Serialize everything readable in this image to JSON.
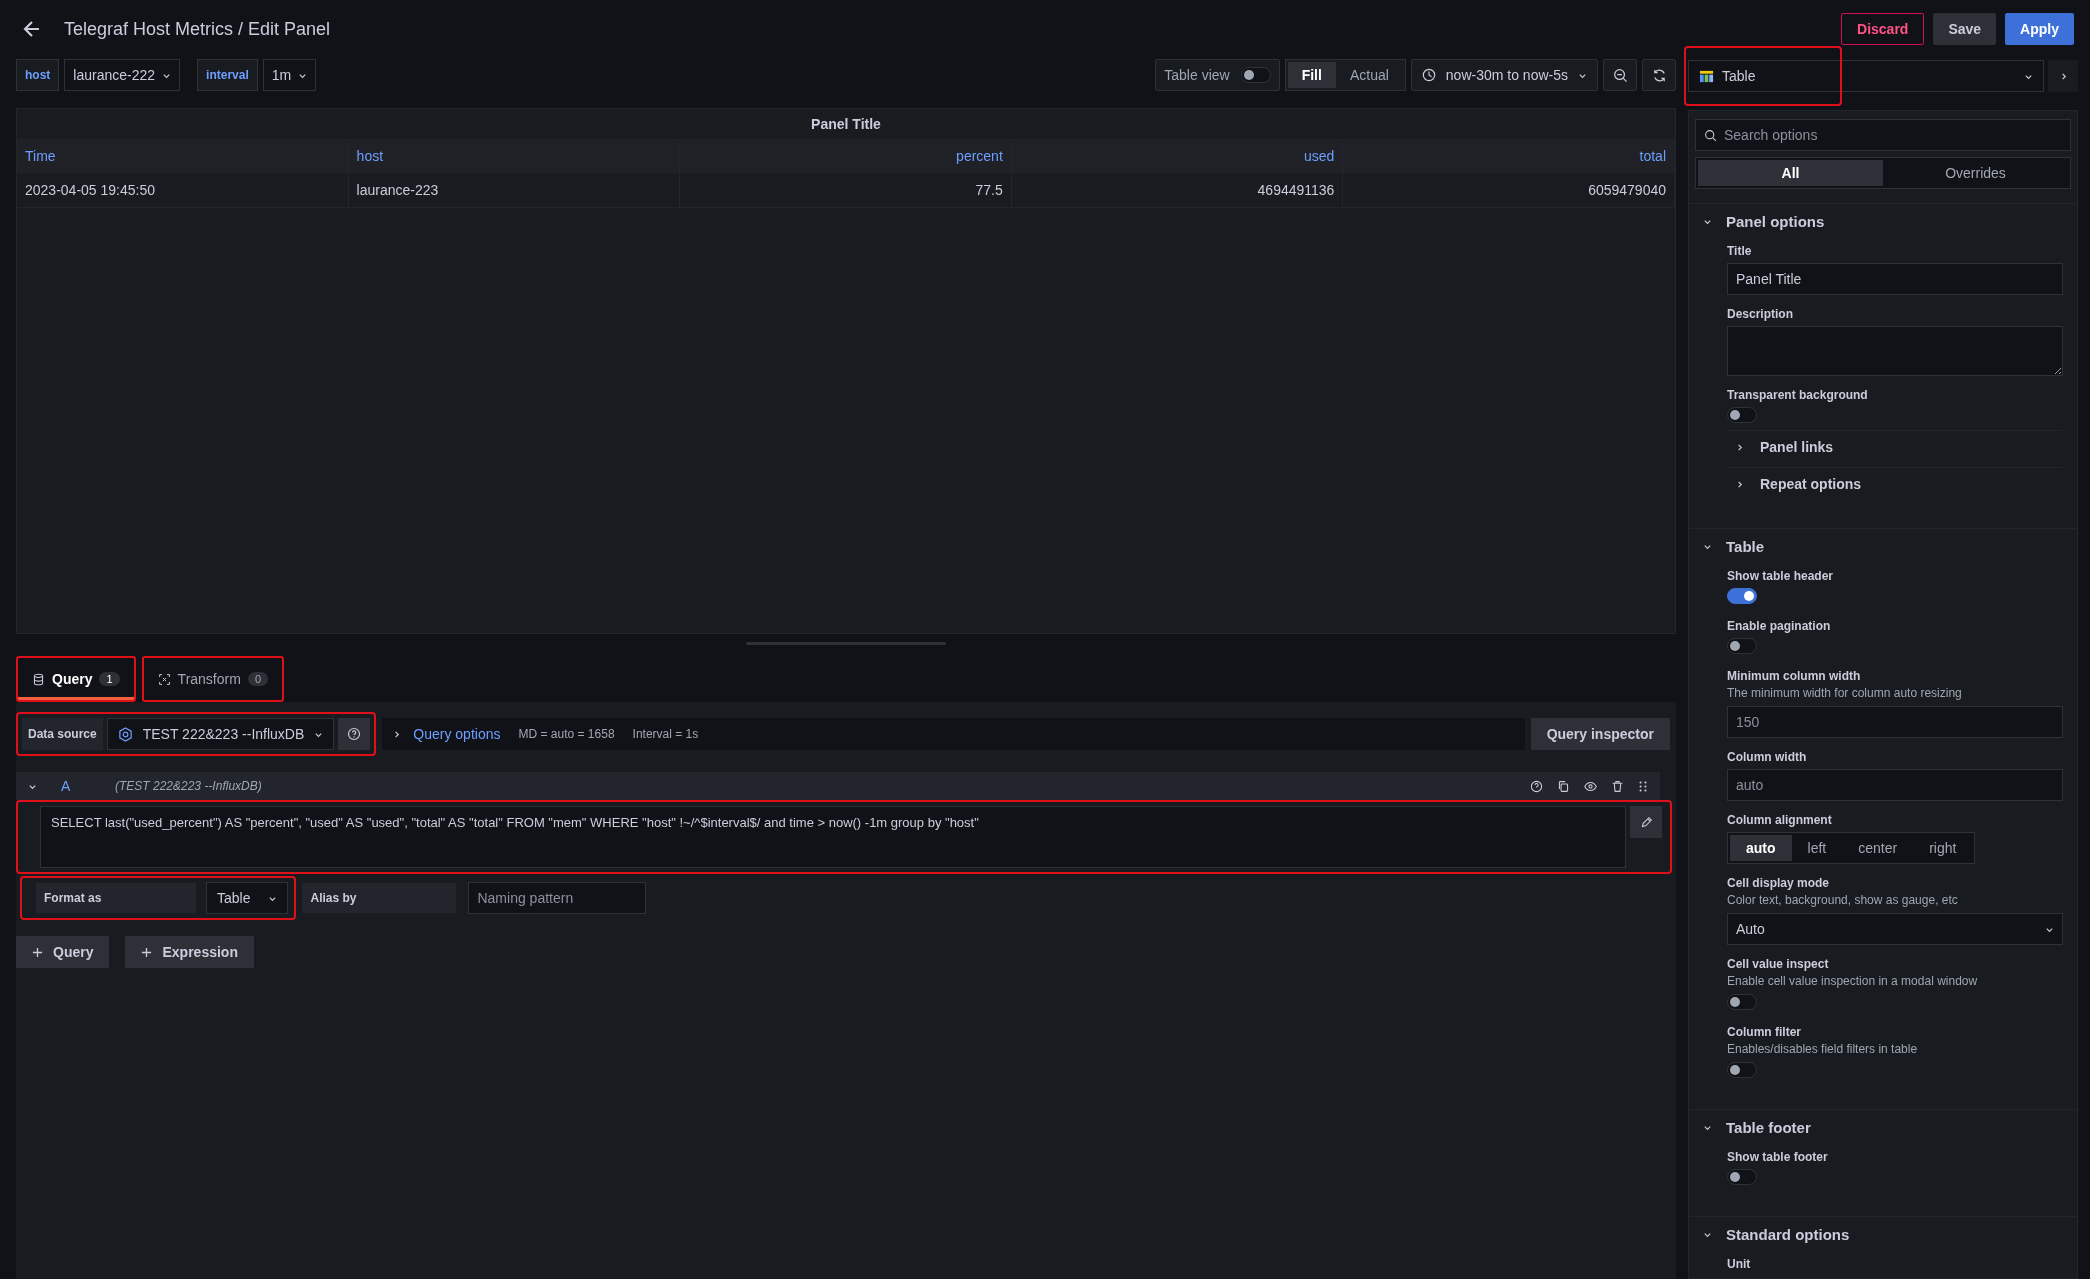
{
  "header": {
    "title": "Telegraf Host Metrics / Edit Panel",
    "buttons": [
      {
        "label": "Discard",
        "kind": "danger"
      },
      {
        "label": "Save",
        "kind": "secondary"
      },
      {
        "label": "Apply",
        "kind": "primary"
      }
    ]
  },
  "variables": [
    {
      "label": "host",
      "value": "laurance-222"
    },
    {
      "label": "interval",
      "value": "1m"
    }
  ],
  "toolbar": {
    "table_view": {
      "label": "Table view",
      "on": false
    },
    "fill_modes": [
      {
        "label": "Fill",
        "selected": true
      },
      {
        "label": "Actual",
        "selected": false
      }
    ],
    "time_range": "now-30m to now-5s"
  },
  "visualization": {
    "name": "Table",
    "highlighted": true
  },
  "panel": {
    "title": "Panel Title",
    "columns": [
      "Time",
      "host",
      "percent",
      "used",
      "total"
    ],
    "rows": [
      [
        "2023-04-05 19:45:50",
        "laurance-223",
        "77.5",
        "4694491136",
        "6059479040"
      ]
    ]
  },
  "query_tabs": [
    {
      "label": "Query",
      "count": "1",
      "selected": true,
      "highlighted": true
    },
    {
      "label": "Transform",
      "count": "0",
      "selected": false,
      "highlighted": true
    }
  ],
  "data_source": {
    "label": "Data source",
    "value": "TEST 222&223 --InfluxDB",
    "highlighted": true
  },
  "query_options": {
    "label": "Query options",
    "md": "MD = auto = 1658",
    "interval": "Interval = 1s",
    "inspector": "Query inspector"
  },
  "queries": [
    {
      "ref": "A",
      "source": "(TEST 222&223 --InfluxDB)",
      "expanded": true,
      "sql": "SELECT last(\"used_percent\") AS \"percent\", \"used\" AS \"used\", \"total\" AS \"total\" FROM \"mem\" WHERE  \"host\" !~/^$interval$/ and time > now() -1m group by \"host\"",
      "sql_highlighted": true,
      "format_label": "Format as",
      "format_value": "Table",
      "format_highlighted": true,
      "alias_label": "Alias by",
      "alias_placeholder": "Naming pattern"
    }
  ],
  "add_buttons": [
    "Query",
    "Expression"
  ],
  "options": {
    "search_placeholder": "Search options",
    "tabs": [
      {
        "label": "All",
        "selected": true
      },
      {
        "label": "Overrides",
        "selected": false
      }
    ],
    "sections": [
      {
        "title": "Panel options",
        "expanded": true,
        "fields": [
          {
            "kind": "text",
            "label": "Title",
            "value": "Panel Title"
          },
          {
            "kind": "textarea",
            "label": "Description"
          },
          {
            "kind": "switch",
            "label": "Transparent background",
            "on": false
          },
          {
            "kind": "subsection",
            "label": "Panel links",
            "expanded": false
          },
          {
            "kind": "subsection",
            "label": "Repeat options",
            "expanded": false
          }
        ]
      },
      {
        "title": "Table",
        "expanded": true,
        "fields": [
          {
            "kind": "switch",
            "label": "Show table header",
            "on": true
          },
          {
            "kind": "switch",
            "label": "Enable pagination",
            "on": false
          },
          {
            "kind": "text",
            "label": "Minimum column width",
            "description": "The minimum width for column auto resizing",
            "placeholder": "150"
          },
          {
            "kind": "text",
            "label": "Column width",
            "placeholder": "auto"
          },
          {
            "kind": "radio",
            "label": "Column alignment",
            "options": [
              {
                "label": "auto",
                "selected": true
              },
              {
                "label": "left",
                "selected": false
              },
              {
                "label": "center",
                "selected": false
              },
              {
                "label": "right",
                "selected": false
              }
            ]
          },
          {
            "kind": "select",
            "label": "Cell display mode",
            "description": "Color text, background, show as gauge, etc",
            "value": "Auto"
          },
          {
            "kind": "switch",
            "label": "Cell value inspect",
            "description": "Enable cell value inspection in a modal window",
            "on": false
          },
          {
            "kind": "switch",
            "label": "Column filter",
            "description": "Enables/disables field filters in table",
            "on": false
          }
        ]
      },
      {
        "title": "Table footer",
        "expanded": true,
        "fields": [
          {
            "kind": "switch",
            "label": "Show table footer",
            "on": false
          }
        ]
      },
      {
        "title": "Standard options",
        "expanded": true,
        "fields": [
          {
            "kind": "label",
            "label": "Unit"
          }
        ]
      }
    ]
  }
}
